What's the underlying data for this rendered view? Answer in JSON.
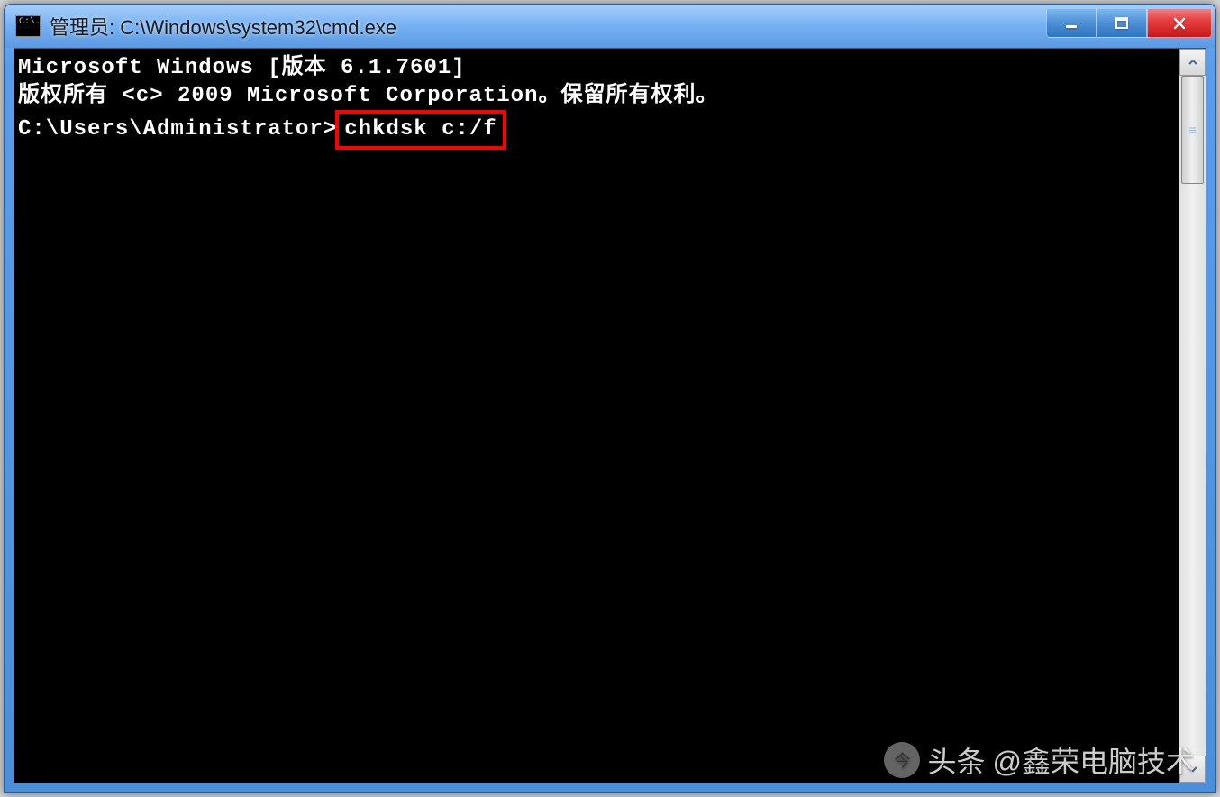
{
  "window": {
    "icon_text": "C:\\.",
    "title": "管理员: C:\\Windows\\system32\\cmd.exe"
  },
  "terminal": {
    "line1": "Microsoft Windows [版本 6.1.7601]",
    "line2": "版权所有 <c> 2009 Microsoft Corporation。保留所有权利。",
    "blank": "",
    "prompt": "C:\\Users\\Administrator>",
    "command": "chkdsk c:/f"
  },
  "highlight": {
    "color": "#ff0000"
  },
  "watermark": {
    "prefix": "头条",
    "text": "@鑫荣电脑技术"
  }
}
